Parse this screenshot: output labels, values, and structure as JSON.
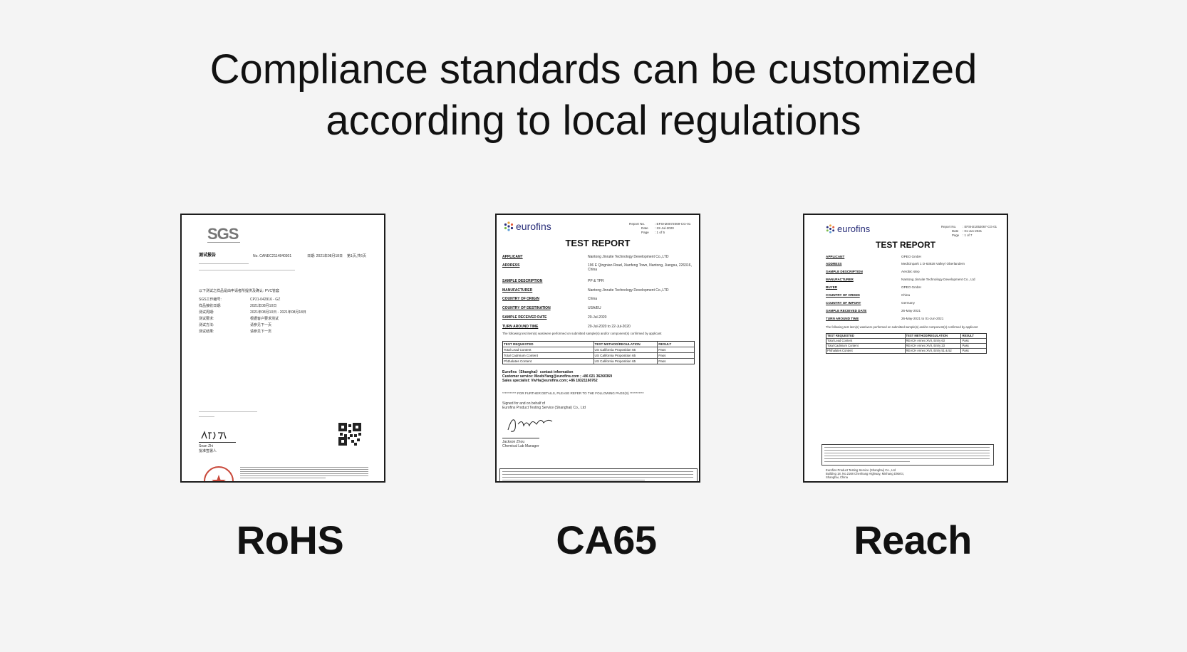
{
  "headline": {
    "line1": "Compliance standards can be customized",
    "line2": "according to local regulations"
  },
  "certificates": [
    {
      "caption": "RoHS",
      "logo": "SGS",
      "report_title": "测试报告",
      "report_no": "No. CANEC2114840301",
      "date": "日期: 2021年08月18日",
      "page": "第1页,共6页",
      "rows": [
        {
          "label": "SGS工作编号:",
          "value": "CP21-042916 - GZ"
        },
        {
          "label": "样品接收日期:",
          "value": "2021年08月10日"
        },
        {
          "label": "测试周期:",
          "value": "2021年08月10日 - 2021年08月18日"
        },
        {
          "label": "测试要求:",
          "value": "根据客户要求测试"
        },
        {
          "label": "测试方法:",
          "value": "请参见下一页"
        },
        {
          "label": "测试结果:",
          "value": "请参见下一页"
        }
      ],
      "sample": "以下测试之样品是由申请者所提供及确认: PVC管套",
      "signer_name": "Sean Zhi",
      "signer_title": "批准签署人"
    },
    {
      "caption": "CA65",
      "logo": "eurofins",
      "report_no_label": "Report No.",
      "report_no": ": EFSH20072069-CG-01",
      "date_label": "Date",
      "date": ": 22-Jul-2020",
      "page_label": "Page",
      "page": ": 1 of 5",
      "heading": "TEST REPORT",
      "fields": [
        {
          "label": "APPLICANT",
          "value": "Nantong Jinruite Technology Development Co.,LTD"
        },
        {
          "label": "ADDRESS",
          "value": "196 E Qingnian Road, Xianfeng Town, Nantong, Jiangsu, 226316, China"
        },
        {
          "label": "SAMPLE DESCRIPTION",
          "value": "PP & TPR"
        },
        {
          "label": "MANUFACTURER",
          "value": "Nantong Jinruite Technology Development Co.,LTD"
        },
        {
          "label": "COUNTRY OF ORIGIN",
          "value": "China"
        },
        {
          "label": "COUNTRY OF DESTINATION",
          "value": "USA/EU"
        },
        {
          "label": "SAMPLE RECEIVED DATE",
          "value": "20-Jul-2020"
        },
        {
          "label": "TURN AROUND TIME",
          "value": "20-Jul-2020 to 22-Jul-2020"
        }
      ],
      "note": "The following test item(s) was/were performed on submitted sample(s) and/or component(s) confirmed by applicant",
      "table_header": [
        "TEST REQUESTED",
        "TEST METHOD/REGULATION",
        "RESULT"
      ],
      "table_rows": [
        [
          "Total Lead Content",
          "US California Proposition 65",
          "Pass"
        ],
        [
          "Total Cadmium Content",
          "US California Proposition 65",
          "Pass"
        ],
        [
          "Phthalates Content",
          "US California Proposition 65",
          "Pass"
        ]
      ],
      "contact_title": "Eurofins（Shanghai）contact information",
      "contact_service": "Customer service: MoebiYang@eurofins.com ; +86 021 36260369",
      "contact_sales": "Sales specialist: VivHa@eurofins.com; +86 18321160762",
      "further": "*********** FOR FURTHER DETAILS, PLEASE REFER TO THE FOLLOWING PAGE(S) ***********",
      "signed1": "Signed for and on behalf of",
      "signed2": "Eurofins Product Testing Service (Shanghai) Co., Ltd",
      "signer_name": "Jackson Zhou",
      "signer_title": "Chemical Lab Manager"
    },
    {
      "caption": "Reach",
      "logo": "eurofins",
      "report_no_label": "Report No.",
      "report_no": ": EFSH21052067-CG-01",
      "date_label": "Date",
      "date": ": 01-Jun-2021",
      "page_label": "Page",
      "page": ": 1 of 7",
      "heading": "TEST REPORT",
      "fields": [
        {
          "label": "APPLICANT",
          "value": "OPEO GmbH"
        },
        {
          "label": "ADDRESS",
          "value": "Medicinpark 1 D-63628 Valley/ Oberlandern"
        },
        {
          "label": "SAMPLE DESCRIPTION",
          "value": "Aerobic step"
        },
        {
          "label": "MANUFACTURER",
          "value": "Nantong Jinruite Technology Development Co., Ltd"
        },
        {
          "label": "BUYER",
          "value": "OPEO GmbH"
        },
        {
          "label": "COUNTRY OF ORIGIN",
          "value": "China"
        },
        {
          "label": "COUNTRY OF IMPORT",
          "value": "Germany"
        },
        {
          "label": "SAMPLE RECEIVED DATE",
          "value": "26-May-2021"
        },
        {
          "label": "TURN AROUND TIME",
          "value": "26-May-2021 to 01-Jun-2021"
        }
      ],
      "note": "The following test item(s) was/were performed on submitted sample(s) and/or component(s) confirmed by applicant",
      "table_header": [
        "TEST REQUESTED",
        "TEST METHOD/REGULATION",
        "RESULT"
      ],
      "table_rows": [
        [
          "Total Lead Content",
          "REACH Annex XVII, Entry 63",
          "Pass"
        ],
        [
          "Total Cadmium Content",
          "REACH Annex XVII, Entry 23",
          "Pass"
        ],
        [
          "Phthalates Content",
          "REACH Annex XVII, Entry 51 & 52",
          "Pass"
        ]
      ],
      "footer1": "Eurofins Product Testing Service (Shanghai) Co., Ltd",
      "footer2": "Building 18, No.2168 Chenhang Highway, Minhang District,",
      "footer3": "Shanghai, China"
    }
  ]
}
